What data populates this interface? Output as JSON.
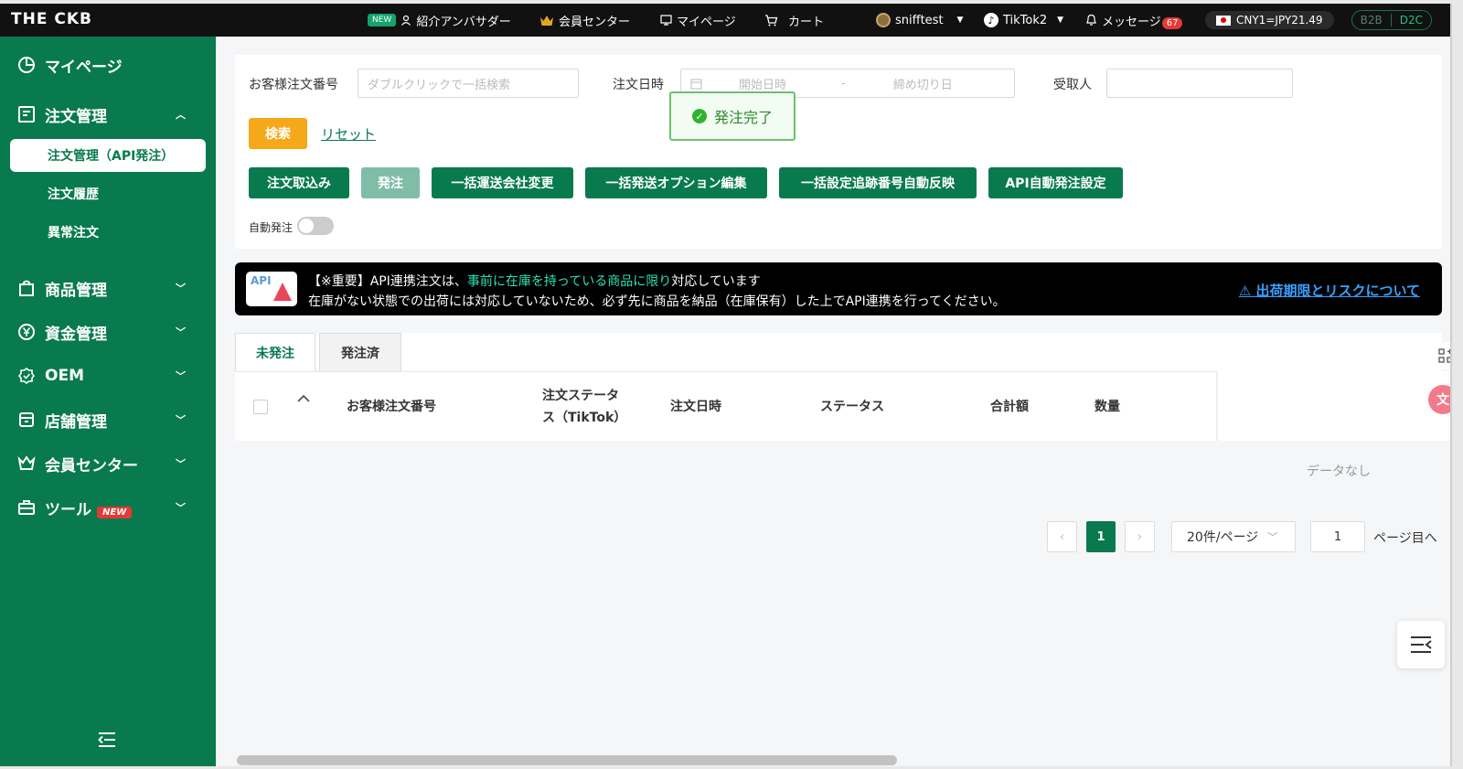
{
  "topbar": {
    "logo": "THE CKB",
    "new_badge": "NEW",
    "ambassador": "紹介アンバサダー",
    "member_center": "会員センター",
    "mypage": "マイページ",
    "cart": "カート",
    "user": "snifftest",
    "shop": "TikTok2",
    "messages": "メッセージ",
    "message_count": "67",
    "rate": "CNY1=JPY21.49",
    "mode_b2b": "B2B",
    "mode_d2c": "D2C"
  },
  "sidebar": {
    "mypage": "マイページ",
    "order_mgmt": "注文管理",
    "sub_api": "注文管理（API発注）",
    "sub_history": "注文履歴",
    "sub_abnormal": "異常注文",
    "product_mgmt": "商品管理",
    "fund_mgmt": "資金管理",
    "oem": "OEM",
    "store_mgmt": "店舗管理",
    "member_center": "会員センター",
    "tools": "ツール",
    "tools_badge": "NEW"
  },
  "filters": {
    "order_no_label": "お客様注文番号",
    "order_no_placeholder": "ダブルクリックで一括検索",
    "date_label": "注文日時",
    "date_start": "開始日時",
    "date_sep": "-",
    "date_end": "締め切り日",
    "recipient_label": "受取人",
    "search": "検索",
    "reset": "リセット"
  },
  "actions": {
    "import": "注文取込み",
    "order": "発注",
    "bulk_carrier": "一括運送会社変更",
    "bulk_option": "一括発送オプション編集",
    "bulk_tracking": "一括設定追跡番号自動反映",
    "api_auto": "API自動発注設定",
    "auto_order_label": "自動発注"
  },
  "toast": "発注完了",
  "notice": {
    "icon_text": "API",
    "line1_prefix": "【※重要】API連携注文は、",
    "line1_highlight": "事前に在庫を持っている商品に限り",
    "line1_suffix": "対応しています",
    "line2": "在庫がない状態での出荷には対応していないため、必ず先に商品を納品（在庫保有）した上でAPI連携を行ってください。",
    "risk_link": "出荷期限とリスクについて"
  },
  "tabs": [
    "未発注",
    "発注済"
  ],
  "table": {
    "headers": {
      "order_no": "お客様注文番号",
      "status_tiktok_1": "注文ステータ",
      "status_tiktok_2": "ス（TikTok）",
      "date": "注文日時",
      "status": "ステータス",
      "total": "合計額",
      "qty": "数量"
    },
    "empty": "データなし"
  },
  "pagination": {
    "prev": "‹",
    "current": "1",
    "next": "›",
    "page_size": "20件/ページ",
    "goto_value": "1",
    "goto_label": "ページ目へ"
  },
  "colors": {
    "brand_green": "#087a4e",
    "search_orange": "#f5a818",
    "highlight_cyan": "#2ee0b5",
    "link_blue": "#39a0ff"
  }
}
